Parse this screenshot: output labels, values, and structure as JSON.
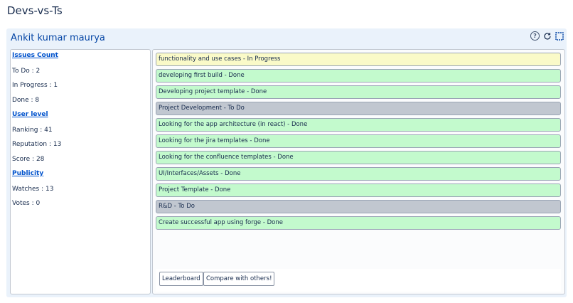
{
  "app": {
    "title": "Devs-vs-Ts"
  },
  "user": {
    "name": "Ankit kumar maurya"
  },
  "header_icons": [
    "help-icon",
    "refresh-icon",
    "expand-icon"
  ],
  "stats": {
    "issues_heading": "Issues Count",
    "todo": "To Do : 2",
    "in_progress": "In Progress : 1",
    "done": "Done : 8",
    "level_heading": "User level",
    "ranking": "Ranking : 41",
    "reputation": "Reputation : 13",
    "score": "Score : 28",
    "publicity_heading": "Publicity",
    "watches": "Watches : 13",
    "votes": "Votes : 0"
  },
  "tasks": [
    {
      "text": "functionality and use cases - In Progress",
      "status": "progress",
      "color": "#fafac8"
    },
    {
      "text": "developing first build - Done",
      "status": "done",
      "color": "#c3facd"
    },
    {
      "text": "Developing project template - Done",
      "status": "done",
      "color": "#c3facd"
    },
    {
      "text": "Project Development - To Do",
      "status": "todo",
      "color": "#c1c7d0"
    },
    {
      "text": "Looking for the app architecture (in react) - Done",
      "status": "done",
      "color": "#c3facd"
    },
    {
      "text": "Looking for the jira templates - Done",
      "status": "done",
      "color": "#c3facd"
    },
    {
      "text": "Looking for the confluence templates - Done",
      "status": "done",
      "color": "#c3facd"
    },
    {
      "text": "UI/Interfaces/Assets - Done",
      "status": "done",
      "color": "#c3facd"
    },
    {
      "text": "Project Template - Done",
      "status": "done",
      "color": "#c3facd"
    },
    {
      "text": "R&D - To Do",
      "status": "todo",
      "color": "#c1c7d0"
    },
    {
      "text": "Create successful app using forge - Done",
      "status": "done",
      "color": "#c3facd"
    }
  ],
  "buttons": {
    "leaderboard": "Leaderboard",
    "compare": "Compare with others!"
  },
  "help_glyph": "?"
}
